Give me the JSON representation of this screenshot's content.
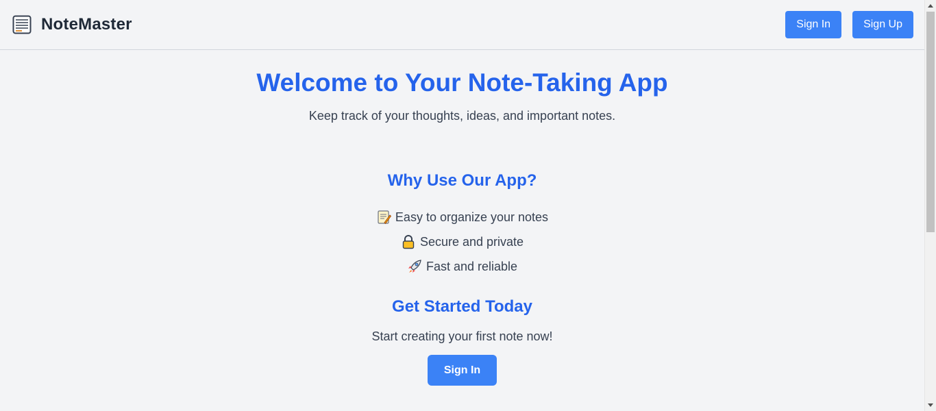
{
  "header": {
    "brand_name": "NoteMaster",
    "brand_icon": "notepad-icon",
    "sign_in_label": "Sign In",
    "sign_up_label": "Sign Up"
  },
  "hero": {
    "title": "Welcome to Your Note-Taking App",
    "subtitle": "Keep track of your thoughts, ideas, and important notes."
  },
  "why": {
    "title": "Why Use Our App?",
    "features": [
      {
        "icon": "memo-icon",
        "label": "Easy to organize your notes"
      },
      {
        "icon": "lock-icon",
        "label": "Secure and private"
      },
      {
        "icon": "rocket-icon",
        "label": "Fast and reliable"
      }
    ]
  },
  "cta": {
    "title": "Get Started Today",
    "subtitle": "Start creating your first note now!",
    "button_label": "Sign In"
  },
  "colors": {
    "accent": "#2563eb",
    "button": "#3b82f6",
    "background": "#f3f4f6"
  }
}
